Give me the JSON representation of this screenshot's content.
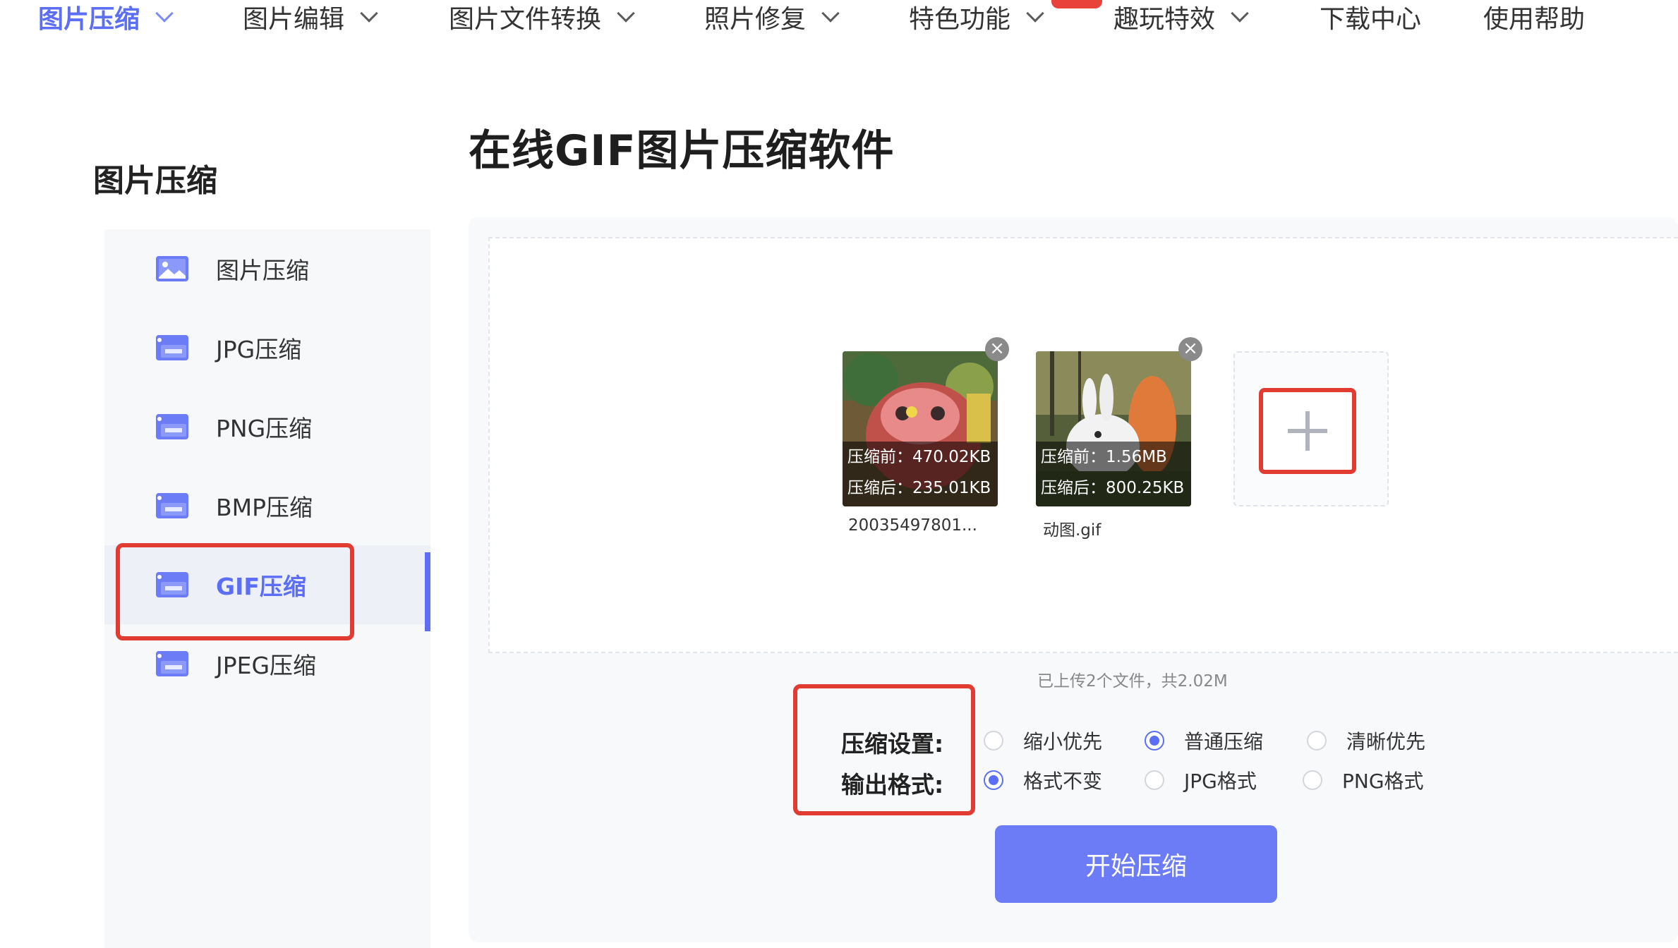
{
  "colors": {
    "accent": "#5b6ef5",
    "highlight_red": "#e23b32",
    "button": "#6b7cf6"
  },
  "nav": {
    "items": [
      {
        "label": "图片压缩",
        "active": true
      },
      {
        "label": "图片编辑"
      },
      {
        "label": "图片文件转换"
      },
      {
        "label": "照片修复"
      },
      {
        "label": "特色功能"
      },
      {
        "label": "趣玩特效"
      },
      {
        "label": "下载中心"
      },
      {
        "label": "使用帮助"
      }
    ]
  },
  "sidebar": {
    "title": "图片压缩",
    "items": [
      {
        "label": "图片压缩",
        "icon": "image-icon"
      },
      {
        "label": "JPG压缩",
        "icon": "jpg-file-icon"
      },
      {
        "label": "PNG压缩",
        "icon": "png-file-icon"
      },
      {
        "label": "BMP压缩",
        "icon": "bmp-file-icon"
      },
      {
        "label": "GIF压缩",
        "icon": "gif-file-icon",
        "active": true
      },
      {
        "label": "JPEG压缩",
        "icon": "jpeg-file-icon"
      }
    ]
  },
  "main": {
    "title": "在线GIF图片压缩软件",
    "files": [
      {
        "before": "压缩前：470.02KB",
        "after": "压缩后：235.01KB",
        "name": "20035497801..."
      },
      {
        "before": "压缩前：1.56MB",
        "after": "压缩后：800.25KB",
        "name": "动图.gif"
      }
    ],
    "upload_status": "已上传2个文件，共2.02M",
    "settings": {
      "compress_label": "压缩设置:",
      "compress_options": [
        "缩小优先",
        "普通压缩",
        "清晰优先"
      ],
      "compress_selected": "普通压缩",
      "format_label": "输出格式:",
      "format_options": [
        "格式不变",
        "JPG格式",
        "PNG格式"
      ],
      "format_selected": "格式不变"
    },
    "start_button": "开始压缩"
  }
}
